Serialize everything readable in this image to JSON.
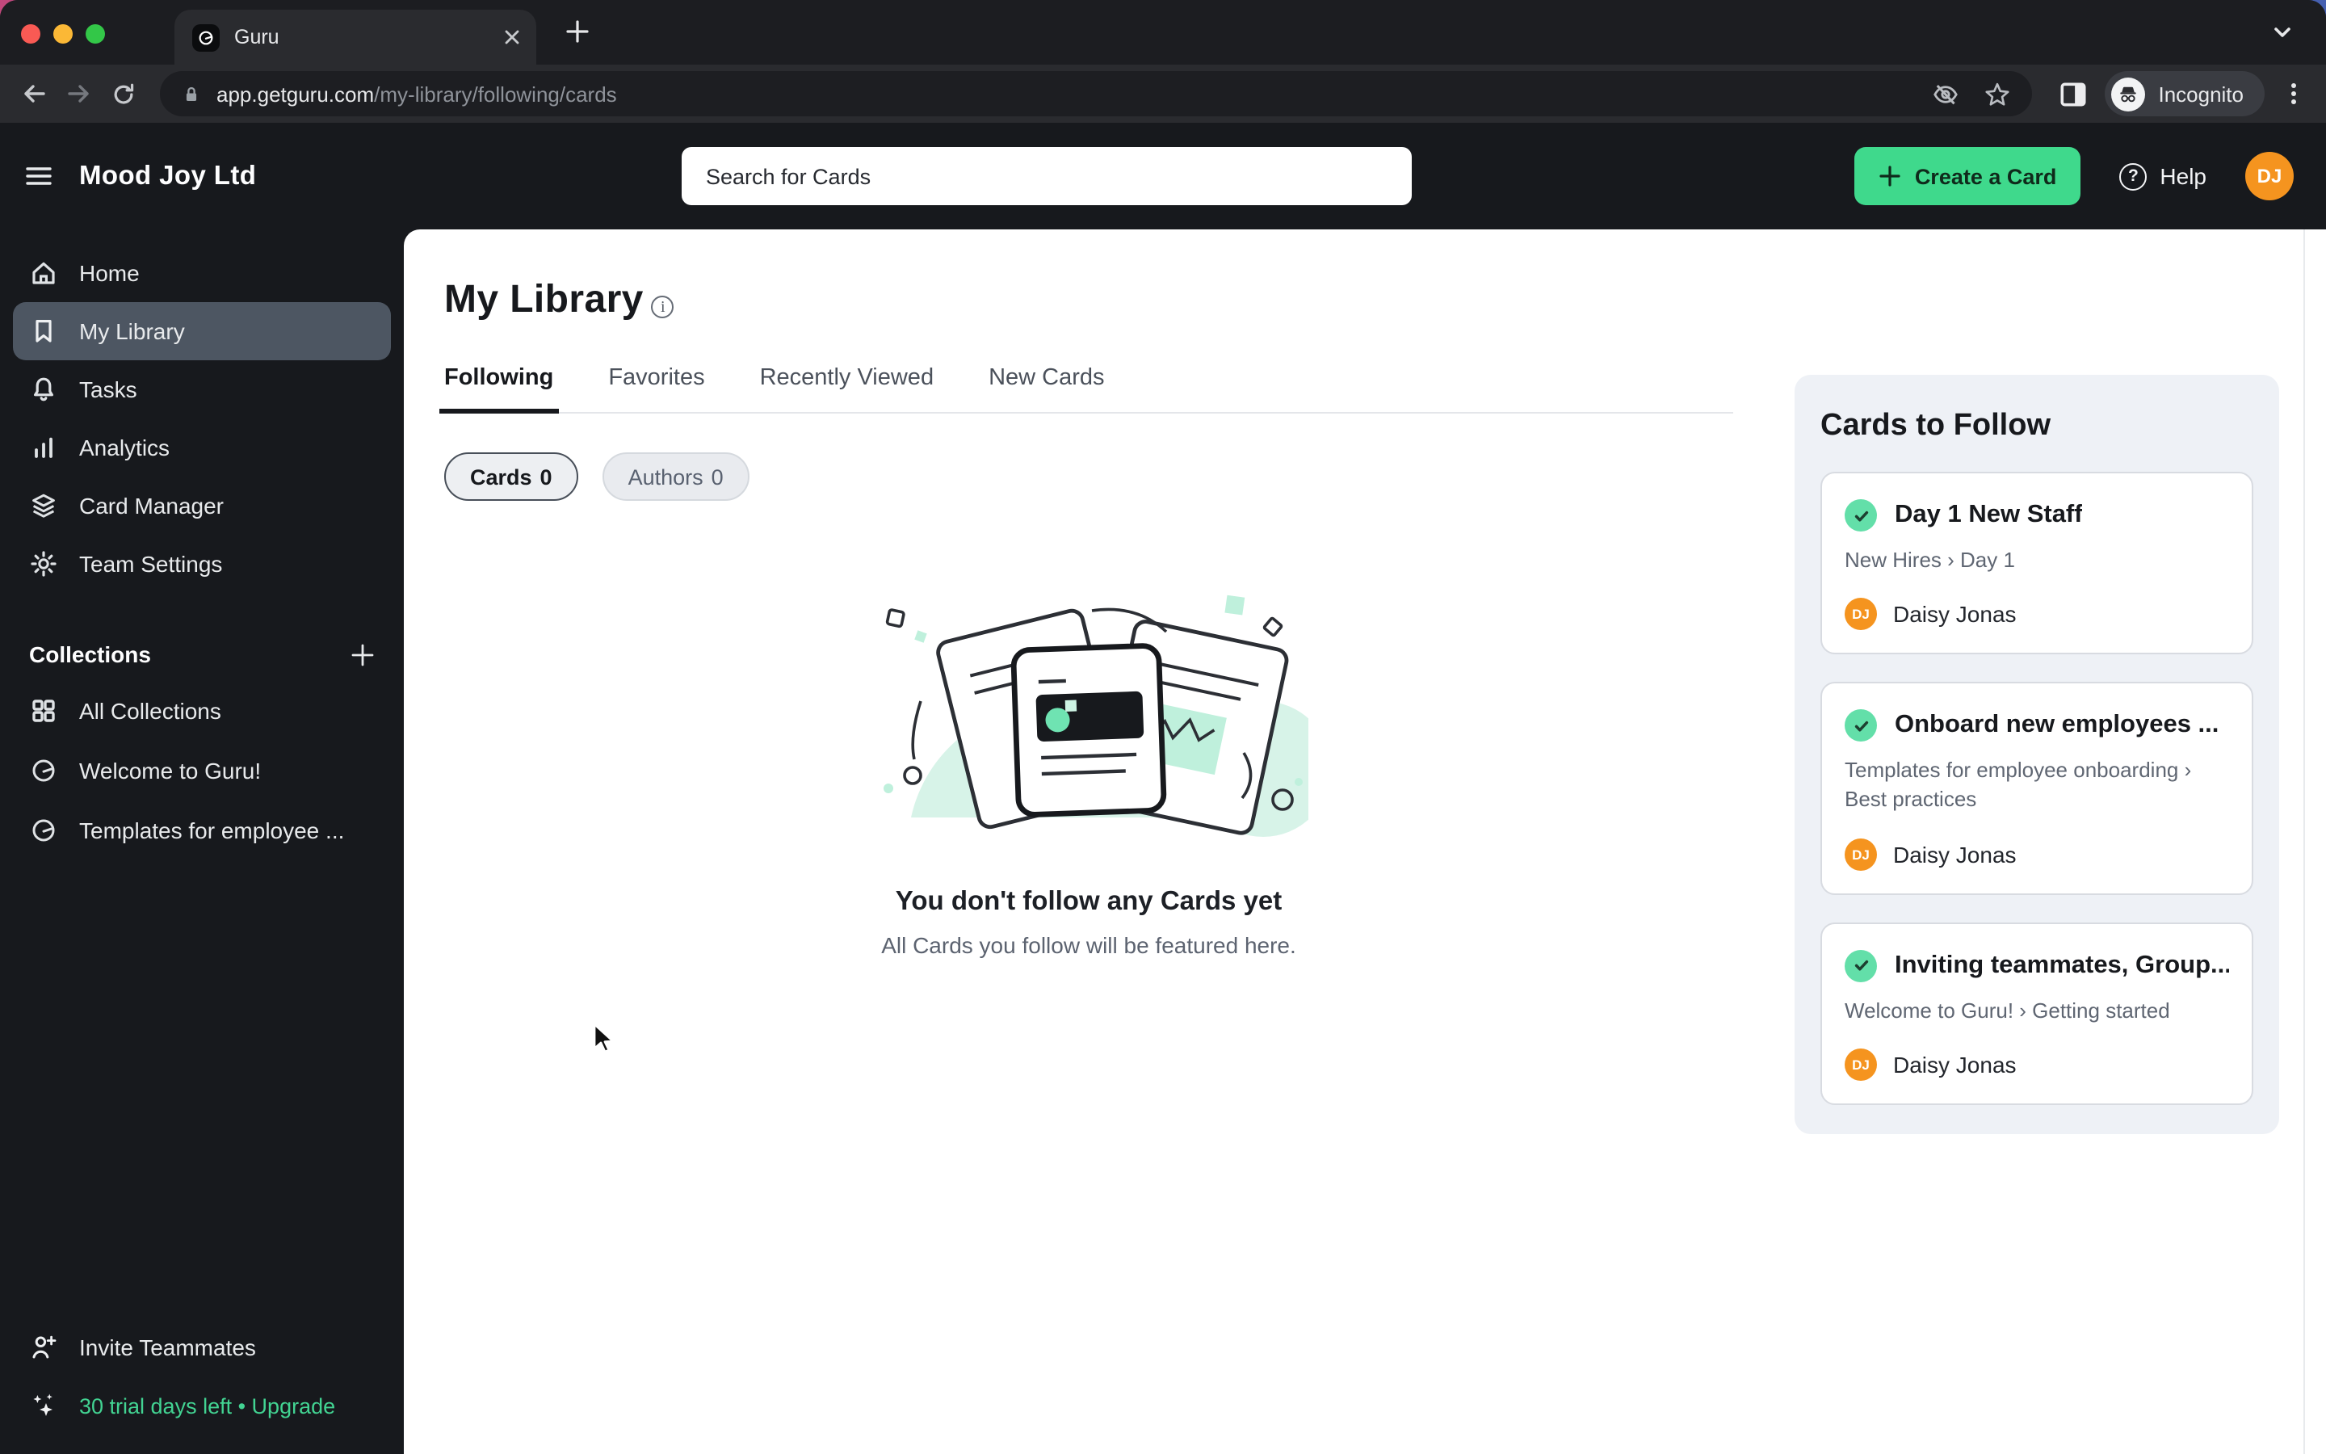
{
  "browser": {
    "tab_title": "Guru",
    "url_host": "app.getguru.com",
    "url_path": "/my-library/following/cards",
    "incognito_label": "Incognito"
  },
  "header": {
    "org_name": "Mood Joy Ltd",
    "search_placeholder": "Search for Cards",
    "create_label": "Create a Card",
    "help_label": "Help",
    "help_glyph": "?",
    "avatar_initials": "DJ"
  },
  "sidebar": {
    "items": [
      {
        "label": "Home"
      },
      {
        "label": "My Library"
      },
      {
        "label": "Tasks"
      },
      {
        "label": "Analytics"
      },
      {
        "label": "Card Manager"
      },
      {
        "label": "Team Settings"
      }
    ],
    "collections_title": "Collections",
    "collections": [
      {
        "label": "All Collections"
      },
      {
        "label": "Welcome to Guru!"
      },
      {
        "label": "Templates for employee ..."
      }
    ],
    "invite_label": "Invite Teammates",
    "trial_label": "30 trial days left • Upgrade"
  },
  "main": {
    "title": "My Library",
    "info_glyph": "i",
    "tabs": [
      {
        "label": "Following"
      },
      {
        "label": "Favorites"
      },
      {
        "label": "Recently Viewed"
      },
      {
        "label": "New Cards"
      }
    ],
    "filters": [
      {
        "label": "Cards",
        "count": "0"
      },
      {
        "label": "Authors",
        "count": "0"
      }
    ],
    "empty_title": "You don't follow any Cards yet",
    "empty_subtitle": "All Cards you follow will be featured here."
  },
  "follow_panel": {
    "title": "Cards to Follow",
    "cards": [
      {
        "title": "Day 1 New Staff",
        "breadcrumb": "New Hires › Day 1",
        "author": "Daisy Jonas",
        "initials": "DJ"
      },
      {
        "title": "Onboard new employees ...",
        "breadcrumb": "Templates for employee onboarding › Best practices",
        "author": "Daisy Jonas",
        "initials": "DJ"
      },
      {
        "title": "Inviting teammates, Group...",
        "breadcrumb": "Welcome to Guru! › Getting started",
        "author": "Daisy Jonas",
        "initials": "DJ"
      }
    ]
  },
  "colors": {
    "accent_green": "#3fd98c",
    "check_green": "#63dfa9",
    "avatar_orange": "#f5941f",
    "trial_green": "#42d392",
    "panel_bg": "#eef1f6",
    "sidebar_bg": "#17191d"
  }
}
